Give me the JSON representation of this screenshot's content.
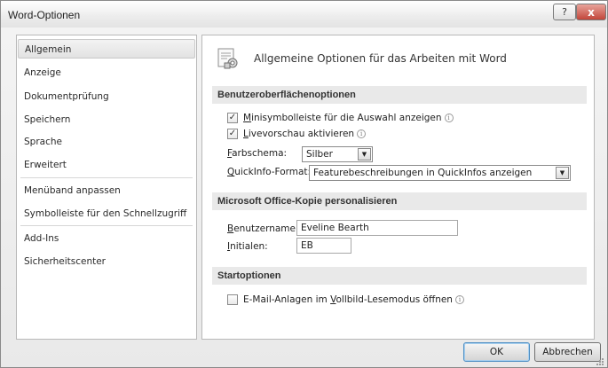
{
  "window": {
    "title": "Word-Optionen",
    "help_label": "?",
    "close_label": "x"
  },
  "sidebar": {
    "items": [
      {
        "label": "Allgemein",
        "selected": true
      },
      {
        "label": "Anzeige"
      },
      {
        "label": "Dokumentprüfung"
      },
      {
        "label": "Speichern"
      },
      {
        "label": "Sprache"
      },
      {
        "label": "Erweitert"
      },
      {
        "label": "Menüband anpassen"
      },
      {
        "label": "Symbolleiste für den Schnellzugriff"
      },
      {
        "label": "Add-Ins"
      },
      {
        "label": "Sicherheitscenter"
      }
    ]
  },
  "content": {
    "header": "Allgemeine Optionen für das Arbeiten mit Word",
    "ui_options": {
      "title": "Benutzeroberflächenoptionen",
      "mini_toolbar": {
        "accel": "M",
        "label_rest": "inisymbolleiste für die Auswahl anzeigen",
        "checked": true,
        "check_glyph": "✓"
      },
      "live_preview": {
        "accel": "L",
        "label_rest": "ivevorschau aktivieren",
        "checked": true,
        "check_glyph": "✓"
      },
      "color_scheme": {
        "accel": "F",
        "label_rest": "arbschema:",
        "value": "Silber"
      },
      "screentip": {
        "accel": "Q",
        "label_rest": "uickInfo-Format:",
        "value": "Featurebeschreibungen in QuickInfos anzeigen"
      }
    },
    "personalize": {
      "title": "Microsoft Office-Kopie personalisieren",
      "username": {
        "accel": "B",
        "label_rest": "enutzername:",
        "value": "Eveline Bearth"
      },
      "initials": {
        "accel": "I",
        "label_rest": "nitialen:",
        "value": "EB"
      }
    },
    "startup": {
      "title": "Startoptionen",
      "reading_mode": {
        "label_pre": "E-Mail-Anlagen im ",
        "accel": "V",
        "label_rest": "ollbild-Lesemodus öffnen",
        "checked": false
      }
    },
    "info_glyph": "i",
    "arrow_glyph": "▼"
  },
  "buttons": {
    "ok": "OK",
    "cancel": "Abbrechen"
  },
  "colors": {
    "section_bg": "#e9e9e9",
    "ok_focus": "#4e8fc4",
    "close_red": "#c2463a"
  }
}
